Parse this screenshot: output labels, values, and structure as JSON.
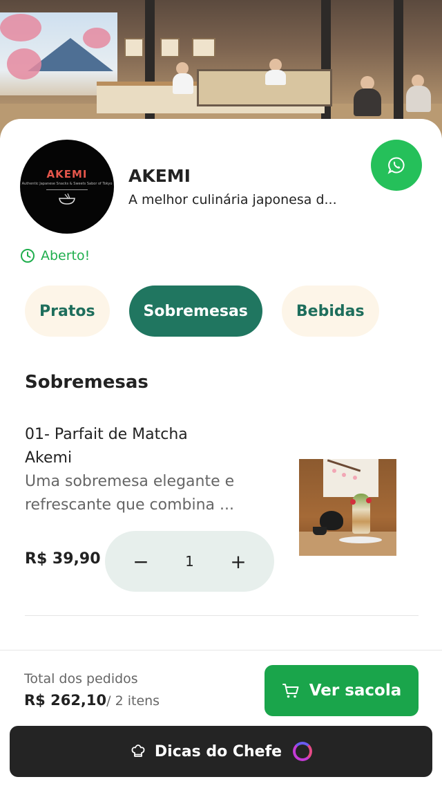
{
  "store": {
    "name": "AKEMI",
    "description": "A melhor culinária japonesa d...",
    "logo_brand": "AKEMI",
    "logo_tagline": "Authentic Japanese Snacks & Sweets Sabor of Tokyo",
    "status": "Aberto!"
  },
  "tabs": [
    {
      "label": "Pratos",
      "active": false
    },
    {
      "label": "Sobremesas",
      "active": true
    },
    {
      "label": "Bebidas",
      "active": false
    }
  ],
  "section": {
    "title": "Sobremesas"
  },
  "item": {
    "name": "01- Parfait de Matcha Akemi",
    "description": "Uma sobremesa elegante e refrescante que combina ...",
    "price": "R$ 39,90",
    "quantity": "1",
    "decrement": "−",
    "increment": "+"
  },
  "cart": {
    "total_label": "Total dos pedidos",
    "total_value": "R$ 262,10",
    "items_count": "/ 2 itens",
    "button_label": "Ver sacola"
  },
  "chef": {
    "label": "Dicas do Chefe"
  },
  "colors": {
    "primary": "#207660",
    "whatsapp": "#25c05a",
    "cart_button": "#1aa54b",
    "status": "#1fae4d",
    "tab_inactive_bg": "#fdf5e8",
    "chef_bar": "#242424"
  },
  "icons": {
    "whatsapp": "whatsapp-icon",
    "clock": "clock-icon",
    "cart": "cart-icon",
    "chef_hat": "chef-hat-icon",
    "loading": "loading-spinner-icon"
  }
}
